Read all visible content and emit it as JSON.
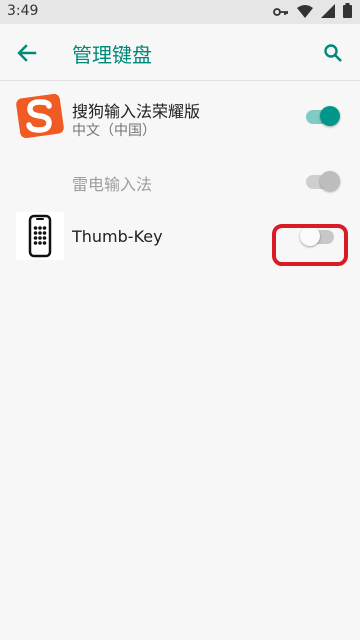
{
  "status_bar": {
    "time": "3:49",
    "icons": [
      "vpn-key-icon",
      "wifi-icon",
      "signal-icon",
      "battery-icon"
    ]
  },
  "app_bar": {
    "title": "管理键盘",
    "back_icon": "arrow-left-icon",
    "search_icon": "search-icon",
    "accent_color": "#00897b"
  },
  "keyboards": [
    {
      "name": "搜狗输入法荣耀版",
      "subtitle": "中文（中国）",
      "icon": "sogou-logo-icon",
      "state": "on"
    },
    {
      "name": "雷电输入法",
      "subtitle": "",
      "icon": "",
      "state": "on-disabled"
    },
    {
      "name": "Thumb-Key",
      "subtitle": "",
      "icon": "thumbkey-phone-icon",
      "state": "off"
    }
  ],
  "colors": {
    "toggle_on": "#009688",
    "highlight": "#d81b24"
  }
}
